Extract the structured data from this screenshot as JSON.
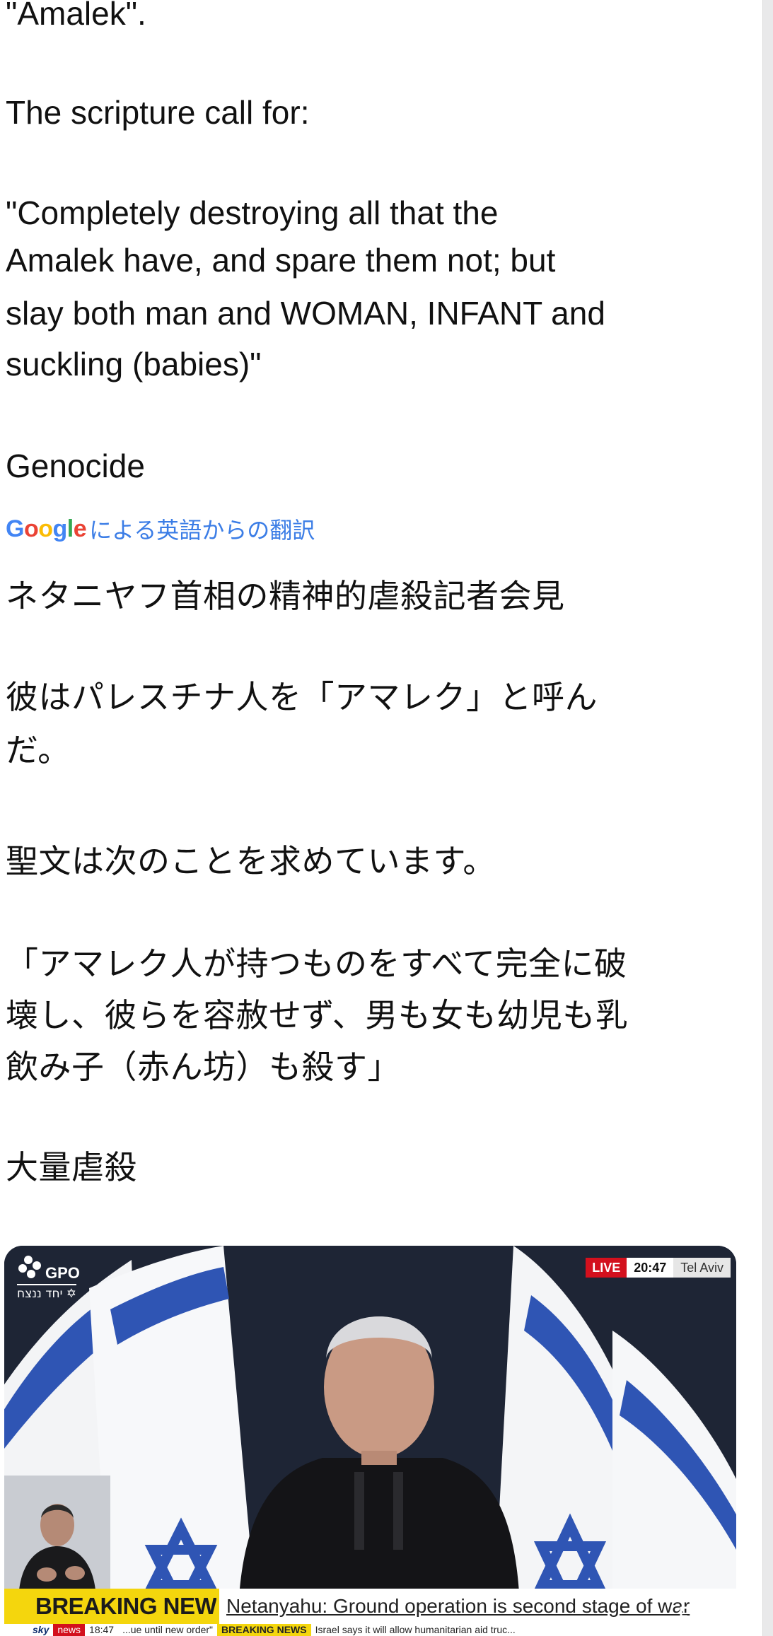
{
  "post": {
    "english_lines": [
      "\"Amalek\".",
      "The scripture call for:",
      " \"Completely destroying all that the",
      "Amalek have, and spare them not; but",
      "slay both man and WOMAN, INFANT and",
      "suckling (babies)\"",
      "Genocide"
    ],
    "translation_badge": {
      "logo": "Google",
      "text": "による英語からの翻訳"
    },
    "japanese_lines": [
      "ネタニヤフ首相の精神的虐殺記者会見",
      "彼はパレスチナ人を「アマレク」と呼ん",
      "だ。",
      "聖文は次のことを求めています。",
      "「アマレク人が持つものをすべて完全に破",
      "壊し、彼らを容赦せず、男も女も幼児も乳",
      "飲み子（赤ん坊）も殺す」",
      "大量虐殺"
    ]
  },
  "video": {
    "gpo_label": "GPO",
    "gpo_hebrew": "יחד ננצח ✡",
    "live_label": "LIVE",
    "time": "20:47",
    "location": "Tel Aviv",
    "breaking_label": "BREAKING NEWS",
    "headline": "Netanyahu: Ground operation is second stage of war",
    "sub_ticker": {
      "brand": "sky",
      "brand_news": "news",
      "time": "18:47",
      "text_left": "...ue until new order\"",
      "breaking": "BREAKING NEWS",
      "text_right": "Israel says it will allow humanitarian aid truc..."
    },
    "mute_icon": "speaker-muted-icon",
    "colors": {
      "ticker_yellow": "#f4d60d",
      "live_red": "#d3101d",
      "flag_blue": "#2f55b4"
    }
  }
}
